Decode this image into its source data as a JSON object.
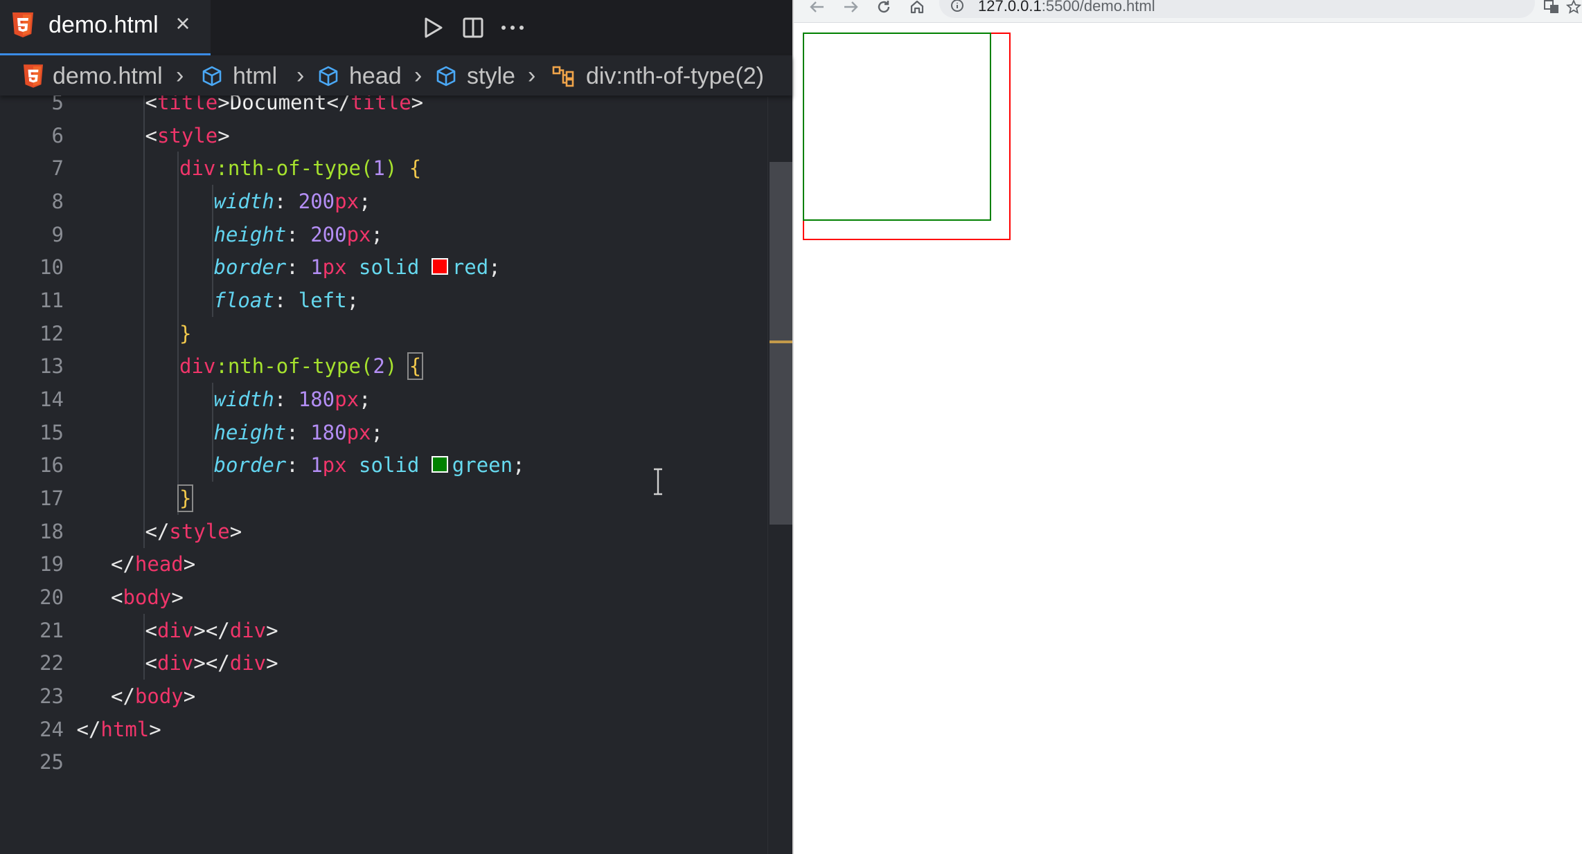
{
  "editor": {
    "tab": {
      "filename": "demo.html",
      "close": "×"
    },
    "breadcrumb": [
      "demo.html",
      "html",
      "head",
      "style",
      "div:nth-of-type(2)"
    ],
    "lines": [
      {
        "n": "5",
        "indent": 2,
        "tokens": [
          [
            "pu",
            "<"
          ],
          [
            "tg",
            "title"
          ],
          [
            "pu",
            ">"
          ],
          [
            "tx",
            "Document"
          ],
          [
            "pu",
            "</"
          ],
          [
            "tg",
            "title"
          ],
          [
            "pu",
            ">"
          ]
        ]
      },
      {
        "n": "6",
        "indent": 2,
        "tokens": [
          [
            "pu",
            "<"
          ],
          [
            "tg",
            "style"
          ],
          [
            "pu",
            ">"
          ]
        ]
      },
      {
        "n": "7",
        "indent": 3,
        "tokens": [
          [
            "sel",
            "div"
          ],
          [
            "fn",
            ":nth-of-type("
          ],
          [
            "num",
            "1"
          ],
          [
            "fn",
            ")"
          ],
          [
            "pu",
            " "
          ],
          [
            "br",
            "{"
          ]
        ]
      },
      {
        "n": "8",
        "indent": 4,
        "tokens": [
          [
            "prop",
            "width"
          ],
          [
            "pu",
            ": "
          ],
          [
            "num",
            "200"
          ],
          [
            "unit",
            "px"
          ],
          [
            "pu",
            ";"
          ]
        ]
      },
      {
        "n": "9",
        "indent": 4,
        "tokens": [
          [
            "prop",
            "height"
          ],
          [
            "pu",
            ": "
          ],
          [
            "num",
            "200"
          ],
          [
            "unit",
            "px"
          ],
          [
            "pu",
            ";"
          ]
        ]
      },
      {
        "n": "10",
        "indent": 4,
        "tokens": [
          [
            "prop",
            "border"
          ],
          [
            "pu",
            ": "
          ],
          [
            "num",
            "1"
          ],
          [
            "unit",
            "px"
          ],
          [
            "val",
            " solid "
          ],
          [
            "swatch",
            "#ff0000"
          ],
          [
            "val",
            "red"
          ],
          [
            "pu",
            ";"
          ]
        ]
      },
      {
        "n": "11",
        "indent": 4,
        "tokens": [
          [
            "prop",
            "float"
          ],
          [
            "pu",
            ": "
          ],
          [
            "val",
            "left"
          ],
          [
            "pu",
            ";"
          ]
        ]
      },
      {
        "n": "12",
        "indent": 3,
        "tokens": [
          [
            "br",
            "}"
          ]
        ]
      },
      {
        "n": "13",
        "indent": 3,
        "tokens": [
          [
            "sel",
            "div"
          ],
          [
            "fn",
            ":nth-of-type("
          ],
          [
            "num",
            "2"
          ],
          [
            "fn",
            ")"
          ],
          [
            "pu",
            " "
          ],
          [
            "brm",
            "{"
          ]
        ]
      },
      {
        "n": "14",
        "indent": 4,
        "tokens": [
          [
            "prop",
            "width"
          ],
          [
            "pu",
            ": "
          ],
          [
            "num",
            "180"
          ],
          [
            "unit",
            "px"
          ],
          [
            "pu",
            ";"
          ]
        ]
      },
      {
        "n": "15",
        "indent": 4,
        "tokens": [
          [
            "prop",
            "height"
          ],
          [
            "pu",
            ": "
          ],
          [
            "num",
            "180"
          ],
          [
            "unit",
            "px"
          ],
          [
            "pu",
            ";"
          ]
        ]
      },
      {
        "n": "16",
        "indent": 4,
        "tokens": [
          [
            "prop",
            "border"
          ],
          [
            "pu",
            ": "
          ],
          [
            "num",
            "1"
          ],
          [
            "unit",
            "px"
          ],
          [
            "val",
            " solid "
          ],
          [
            "swatch",
            "#008000"
          ],
          [
            "val",
            "green"
          ],
          [
            "pu",
            ";"
          ]
        ]
      },
      {
        "n": "17",
        "indent": 3,
        "tokens": [
          [
            "brm",
            "}"
          ]
        ]
      },
      {
        "n": "18",
        "indent": 2,
        "tokens": [
          [
            "pu",
            "</"
          ],
          [
            "tg",
            "style"
          ],
          [
            "pu",
            ">"
          ]
        ]
      },
      {
        "n": "19",
        "indent": 1,
        "tokens": [
          [
            "pu",
            "</"
          ],
          [
            "tg",
            "head"
          ],
          [
            "pu",
            ">"
          ]
        ]
      },
      {
        "n": "20",
        "indent": 1,
        "tokens": [
          [
            "pu",
            "<"
          ],
          [
            "tg",
            "body"
          ],
          [
            "pu",
            ">"
          ]
        ]
      },
      {
        "n": "21",
        "indent": 2,
        "tokens": [
          [
            "pu",
            "<"
          ],
          [
            "tg",
            "div"
          ],
          [
            "pu",
            "></"
          ],
          [
            "tg",
            "div"
          ],
          [
            "pu",
            ">"
          ]
        ]
      },
      {
        "n": "22",
        "indent": 2,
        "tokens": [
          [
            "pu",
            "<"
          ],
          [
            "tg",
            "div"
          ],
          [
            "pu",
            "></"
          ],
          [
            "tg",
            "div"
          ],
          [
            "pu",
            ">"
          ]
        ]
      },
      {
        "n": "23",
        "indent": 1,
        "tokens": [
          [
            "pu",
            "</"
          ],
          [
            "tg",
            "body"
          ],
          [
            "pu",
            ">"
          ]
        ]
      },
      {
        "n": "24",
        "indent": 0,
        "tokens": [
          [
            "pu",
            "</"
          ],
          [
            "tg",
            "html"
          ],
          [
            "pu",
            ">"
          ]
        ]
      },
      {
        "n": "25",
        "indent": 0,
        "tokens": []
      }
    ]
  },
  "browser": {
    "url_host": "127.0.0.1",
    "url_path": ":5500/demo.html"
  },
  "icons": {
    "html5": "html5-icon",
    "symbol": "symbol-class-icon",
    "selector": "symbol-selector-icon",
    "run": "play-icon",
    "split": "split-editor-icon",
    "more": "more-icon",
    "back": "arrow-left-icon",
    "forward": "arrow-right-icon",
    "reload": "reload-icon",
    "home": "home-icon",
    "info": "info-icon"
  },
  "colors": {
    "accent": "#3b8eea",
    "tag": "#f0356a",
    "number": "#b48ef5",
    "property": "#62d4f0",
    "function": "#a6e22e",
    "html5": "#e44d26",
    "cube": "#4aa8f5",
    "selector_icon": "#f0a44a"
  }
}
